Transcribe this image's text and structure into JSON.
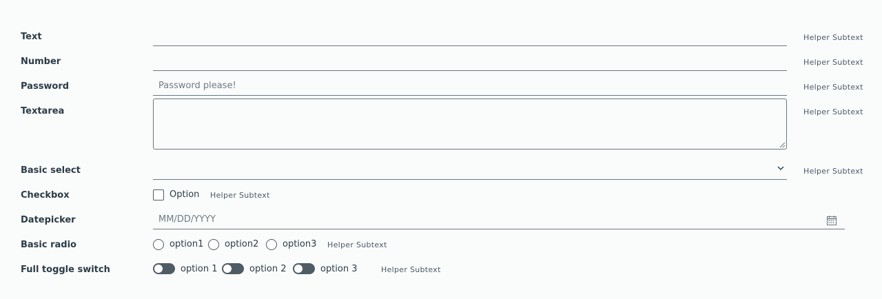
{
  "form": {
    "text": {
      "label": "Text",
      "value": "",
      "helper": "Helper Subtext"
    },
    "number": {
      "label": "Number",
      "value": "",
      "helper": "Helper Subtext"
    },
    "password": {
      "label": "Password",
      "placeholder": "Password please!",
      "helper": "Helper Subtext"
    },
    "textarea": {
      "label": "Textarea",
      "value": "",
      "helper": "Helper Subtext"
    },
    "basic_select": {
      "label": "Basic select",
      "selected": "",
      "helper": "Helper Subtext",
      "icon": "chevron-down-icon"
    },
    "checkbox": {
      "label": "Checkbox",
      "option_label": "Option",
      "checked": false,
      "helper": "Helper Subtext"
    },
    "datepicker": {
      "label": "Datepicker",
      "placeholder": "MM/DD/YYYY",
      "icon": "calendar-icon"
    },
    "basic_radio": {
      "label": "Basic radio",
      "options": [
        "option1",
        "option2",
        "option3"
      ],
      "selected": null,
      "helper": "Helper Subtext"
    },
    "toggle_switch": {
      "label": "Full toggle switch",
      "options": [
        "option 1",
        "option 2",
        "option 3"
      ],
      "states": [
        false,
        false,
        false
      ],
      "helper": "Helper Subtext"
    }
  },
  "colors": {
    "background": "#fafcfc",
    "text": "#2c3b45",
    "border": "#6b7680",
    "toggle": "#4f5c66"
  }
}
